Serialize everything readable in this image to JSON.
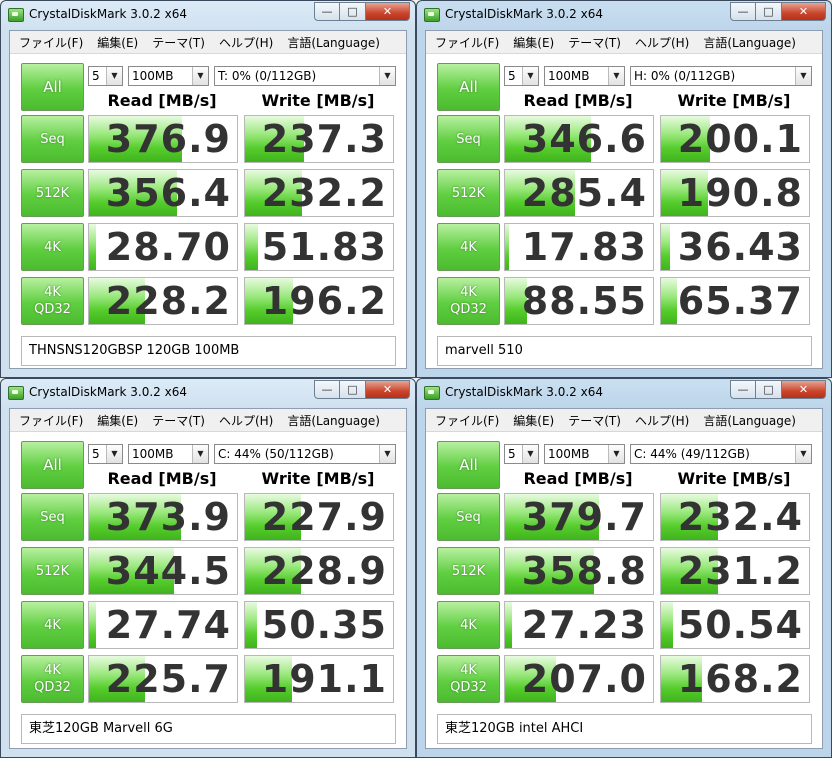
{
  "menu": [
    "ファイル(F)",
    "編集(E)",
    "テーマ(T)",
    "ヘルプ(H)",
    "言語(Language)"
  ],
  "all_label": "All",
  "headers": {
    "read": "Read [MB/s]",
    "write": "Write [MB/s]"
  },
  "row_labels": {
    "seq": "Seq",
    "k512": "512K",
    "k4": "4K",
    "k4qd_line1": "4K",
    "k4qd_line2": "QD32"
  },
  "windows": [
    {
      "title": "CrystalDiskMark 3.0.2 x64",
      "count": "5",
      "size": "100MB",
      "drive": "T: 0% (0/112GB)",
      "seq_read": "376.9",
      "seq_write": "237.3",
      "k512_read": "356.4",
      "k512_write": "232.2",
      "k4_read": "28.70",
      "k4_write": "51.83",
      "qd_read": "228.2",
      "qd_write": "196.2",
      "comment": "THNSNS120GBSP 120GB 100MB"
    },
    {
      "title": "CrystalDiskMark 3.0.2 x64",
      "count": "5",
      "size": "100MB",
      "drive": "H: 0% (0/112GB)",
      "seq_read": "346.6",
      "seq_write": "200.1",
      "k512_read": "285.4",
      "k512_write": "190.8",
      "k4_read": "17.83",
      "k4_write": "36.43",
      "qd_read": "88.55",
      "qd_write": "65.37",
      "comment": "marvell 510"
    },
    {
      "title": "CrystalDiskMark 3.0.2 x64",
      "count": "5",
      "size": "100MB",
      "drive": "C: 44% (50/112GB)",
      "seq_read": "373.9",
      "seq_write": "227.9",
      "k512_read": "344.5",
      "k512_write": "228.9",
      "k4_read": "27.74",
      "k4_write": "50.35",
      "qd_read": "225.7",
      "qd_write": "191.1",
      "comment": "東芝120GB Marvell 6G"
    },
    {
      "title": "CrystalDiskMark 3.0.2 x64",
      "count": "5",
      "size": "100MB",
      "drive": "C: 44% (49/112GB)",
      "seq_read": "379.7",
      "seq_write": "232.4",
      "k512_read": "358.8",
      "k512_write": "231.2",
      "k4_read": "27.23",
      "k4_write": "50.54",
      "qd_read": "207.0",
      "qd_write": "168.2",
      "comment": "東芝120GB intel AHCI"
    }
  ],
  "bar_scale_max_mbps": 600,
  "colors": {
    "bar_green": "#56cd2d",
    "button_green": "#5fce40",
    "close_red": "#c9452c"
  }
}
